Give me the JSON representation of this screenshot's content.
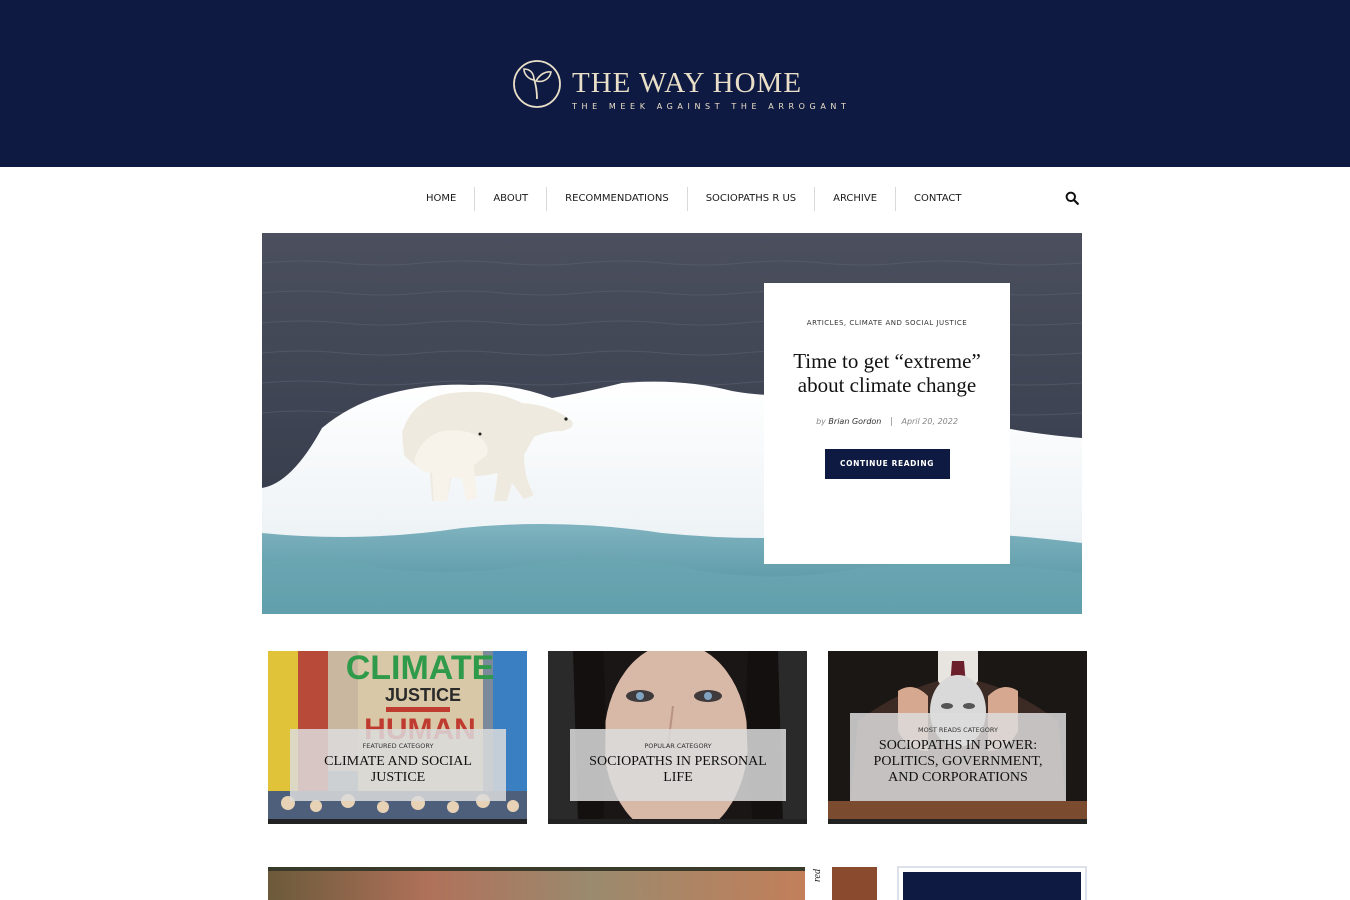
{
  "site": {
    "title": "THE WAY HOME",
    "tagline": "THE MEEK AGAINST THE ARROGANT",
    "logo_icon": "sprout-leaf-icon",
    "brand_color": "#0f1a42",
    "logo_color": "#e9dfc8"
  },
  "nav": {
    "items": [
      {
        "label": "HOME"
      },
      {
        "label": "ABOUT"
      },
      {
        "label": "RECOMMENDATIONS"
      },
      {
        "label": "SOCIOPATHS R US"
      },
      {
        "label": "ARCHIVE"
      },
      {
        "label": "CONTACT"
      }
    ],
    "search_icon": "search-icon"
  },
  "hero": {
    "categories": "ARTICLES, CLIMATE AND SOCIAL JUSTICE",
    "title": "Time to get “extreme” about climate change",
    "by": "by",
    "author": "Brian Gordon",
    "date": "April 20, 2022",
    "button": "CONTINUE READING"
  },
  "tiles": [
    {
      "kicker": "FEATURED CATEGORY",
      "title": "CLIMATE AND SOCIAL JUSTICE",
      "sign_line1": "CLIMATE",
      "sign_line2": "JUSTICE",
      "sign_line3": "HUMAN"
    },
    {
      "kicker": "POPULAR CATEGORY",
      "title": "SOCIOPATHS IN PERSONAL LIFE"
    },
    {
      "kicker": "MOST READS CATEGORY",
      "title": "SOCIOPATHS IN POWER: POLITICS, GOVERNMENT, AND CORPORATIONS"
    }
  ],
  "bottom": {
    "side_text": "red"
  }
}
